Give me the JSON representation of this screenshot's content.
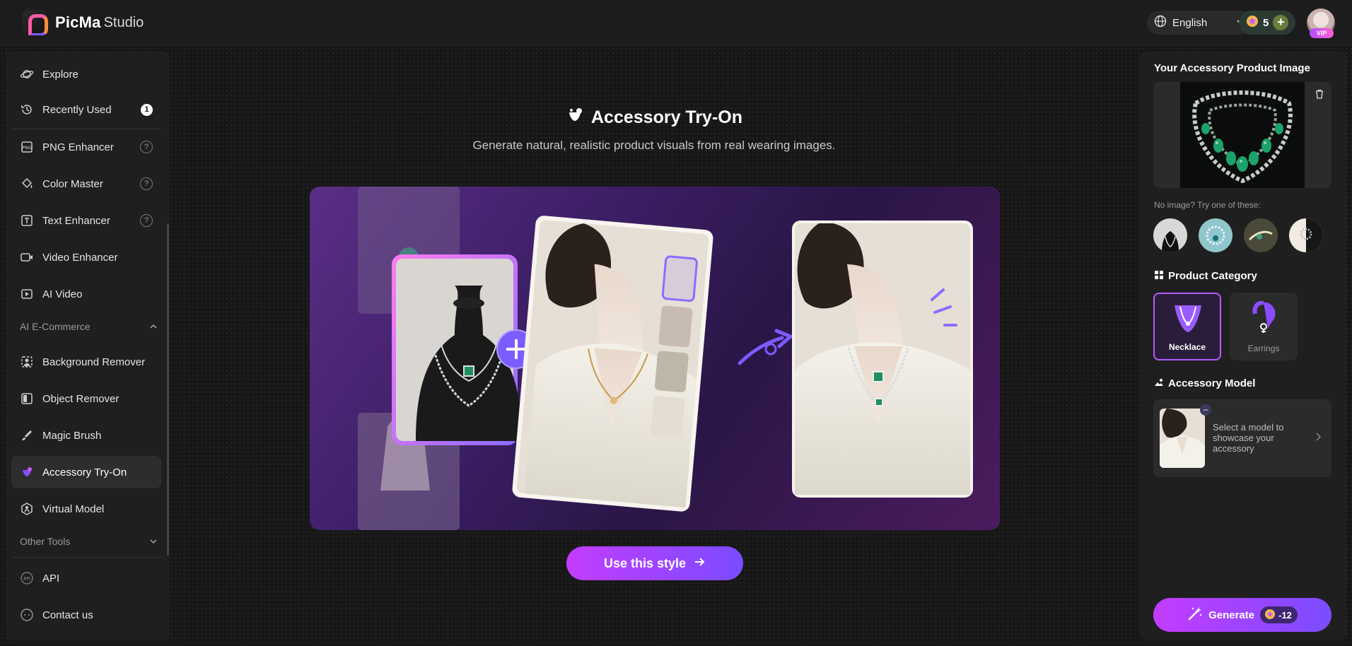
{
  "app": {
    "brand": "PicMa",
    "brand_sub": "Studio"
  },
  "topbar": {
    "language": "English",
    "credits": "5",
    "vip": "VIP"
  },
  "sidebar": {
    "items": [
      {
        "label": "Explore",
        "icon": "planet-icon"
      },
      {
        "label": "Recently Used",
        "icon": "history-icon",
        "badge": "1"
      },
      {
        "label": "PNG Enhancer",
        "icon": "png-icon",
        "help": "?"
      },
      {
        "label": "Color Master",
        "icon": "paint-bucket-icon",
        "help": "?"
      },
      {
        "label": "Text Enhancer",
        "icon": "text-icon",
        "help": "?"
      },
      {
        "label": "Video Enhancer",
        "icon": "video-enhance-icon"
      },
      {
        "label": "AI Video",
        "icon": "play-video-icon"
      },
      {
        "label": "Background Remover",
        "icon": "person-cutout-icon"
      },
      {
        "label": "Object Remover",
        "icon": "object-remove-icon"
      },
      {
        "label": "Magic Brush",
        "icon": "brush-icon"
      },
      {
        "label": "Accessory Try-On",
        "icon": "accessory-icon"
      },
      {
        "label": "Virtual Model",
        "icon": "model-icon"
      },
      {
        "label": "API",
        "icon": "api-icon"
      },
      {
        "label": "Contact us",
        "icon": "chat-icon"
      }
    ],
    "section_ecommerce": "AI E-Commerce",
    "section_other": "Other Tools"
  },
  "main": {
    "title": "Accessory Try-On",
    "subtitle": "Generate natural, realistic product visuals from real wearing images.",
    "cta": "Use this style"
  },
  "panel": {
    "upload_title": "Your Accessory Product Image",
    "samples_hint": "No image? Try one of these:",
    "category_title": "Product Category",
    "categories": [
      {
        "label": "Necklace",
        "selected": true
      },
      {
        "label": "Earrings",
        "selected": false
      }
    ],
    "model_title": "Accessory Model",
    "model_hint": "Select a model to showcase your accessory",
    "generate_label": "Generate",
    "generate_cost": "-12"
  },
  "colors": {
    "accent": "#b45cff",
    "accent2": "#7a4cff",
    "bg": "#171717",
    "panel": "#1f1f1f"
  }
}
